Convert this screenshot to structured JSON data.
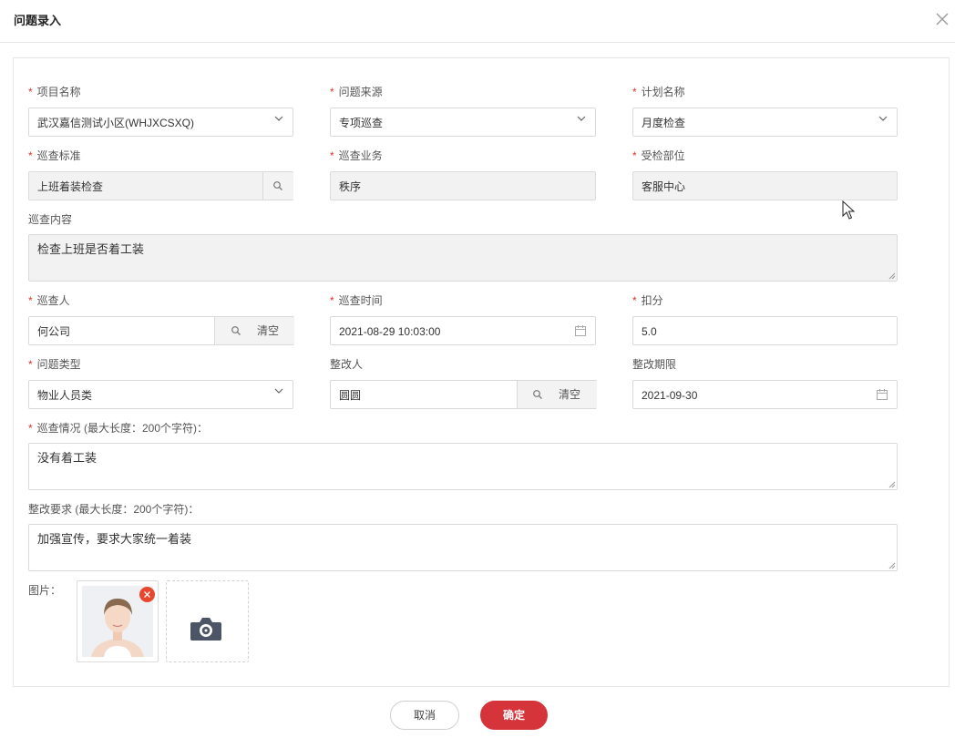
{
  "dialog": {
    "title": "问题录入",
    "close_icon": "close-icon"
  },
  "form": {
    "project_name": {
      "label": "项目名称",
      "required": true,
      "value": "武汉嘉信测试小区(WHJXCSXQ)"
    },
    "issue_source": {
      "label": "问题来源",
      "required": true,
      "value": "专项巡查"
    },
    "plan_name": {
      "label": "计划名称",
      "required": true,
      "value": "月度检查"
    },
    "inspection_standard": {
      "label": "巡查标准",
      "required": true,
      "value": "上班着装检查"
    },
    "inspection_business": {
      "label": "巡查业务",
      "required": true,
      "value": "秩序"
    },
    "inspected_department": {
      "label": "受检部位",
      "required": true,
      "value": "客服中心"
    },
    "inspection_content": {
      "label": "巡查内容",
      "value": "检查上班是否着工装"
    },
    "inspector": {
      "label": "巡查人",
      "required": true,
      "value": "何公司",
      "clear_label": "清空"
    },
    "inspection_time": {
      "label": "巡查时间",
      "required": true,
      "value": "2021-08-29 10:03:00"
    },
    "deduction": {
      "label": "扣分",
      "required": true,
      "value": "5.0"
    },
    "issue_type": {
      "label": "问题类型",
      "required": true,
      "value": "物业人员类"
    },
    "rectifier": {
      "label": "整改人",
      "value": "圆圆",
      "clear_label": "清空"
    },
    "rectify_deadline": {
      "label": "整改期限",
      "value": "2021-09-30"
    },
    "inspection_situation": {
      "label": "巡查情况 (最大长度：200个字符)：",
      "required": true,
      "value": "没有着工装"
    },
    "rectify_requirement": {
      "label": "整改要求 (最大长度：200个字符)：",
      "value": "加强宣传，要求大家统一着装"
    },
    "images": {
      "label": "图片："
    }
  },
  "footer": {
    "cancel_label": "取消",
    "confirm_label": "确定"
  },
  "colors": {
    "accent": "#d5343a",
    "required": "#d9342b",
    "disabled_bg": "#f2f2f2",
    "border": "#d9d9d9"
  }
}
